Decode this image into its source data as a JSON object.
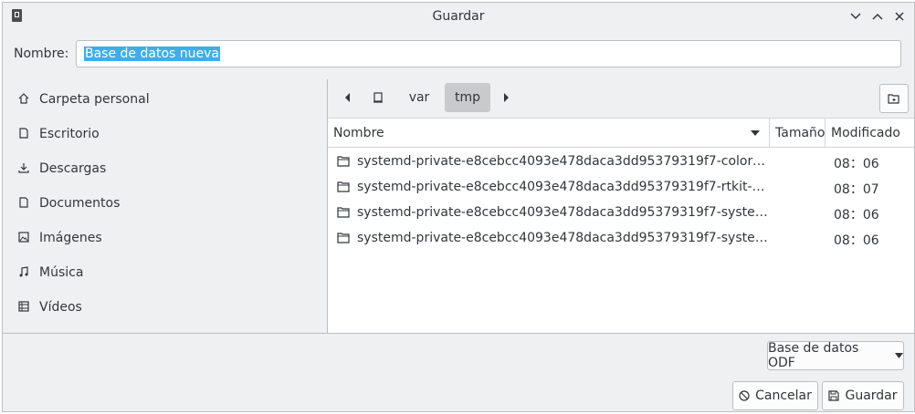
{
  "window": {
    "title": "Guardar"
  },
  "name_row": {
    "label": "Nombre:",
    "value": "Base de datos nueva"
  },
  "sidebar": {
    "items": [
      {
        "label": "Carpeta personal",
        "icon": "home-icon"
      },
      {
        "label": "Escritorio",
        "icon": "desktop-icon"
      },
      {
        "label": "Descargas",
        "icon": "download-icon"
      },
      {
        "label": "Documentos",
        "icon": "document-icon"
      },
      {
        "label": "Imágenes",
        "icon": "image-icon"
      },
      {
        "label": "Música",
        "icon": "music-icon"
      },
      {
        "label": "Vídeos",
        "icon": "video-icon"
      }
    ]
  },
  "pathbar": {
    "segments": [
      "var",
      "tmp"
    ],
    "active": "tmp"
  },
  "columns": {
    "name": "Nombre",
    "size": "Tamaño",
    "modified": "Modificado"
  },
  "files": [
    {
      "name": "systemd-private-e8cebcc4093e478daca3dd95379319f7-colord.service…",
      "size": "",
      "modified": "08：06"
    },
    {
      "name": "systemd-private-e8cebcc4093e478daca3dd95379319f7-rtkit-daemon.…",
      "size": "",
      "modified": "08：07"
    },
    {
      "name": "systemd-private-e8cebcc4093e478daca3dd95379319f7-systemd-resol…",
      "size": "",
      "modified": "08：06"
    },
    {
      "name": "systemd-private-e8cebcc4093e478daca3dd95379319f7-systemd-time…",
      "size": "",
      "modified": "08：06"
    }
  ],
  "filter": {
    "selected": "Base de datos ODF"
  },
  "buttons": {
    "cancel": "Cancelar",
    "save": "Guardar"
  },
  "colors": {
    "selection": "#3daee9",
    "window_bg": "#eff0f1",
    "active_segment": "#c9cacb"
  }
}
